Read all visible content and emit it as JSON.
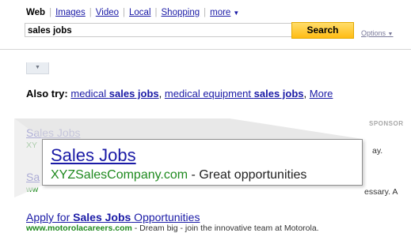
{
  "nav": {
    "web": "Web",
    "images": "Images",
    "video": "Video",
    "local": "Local",
    "shopping": "Shopping",
    "more": "more",
    "separator": "|"
  },
  "search": {
    "query": "sales jobs",
    "button_label": "Search",
    "options_label": "Options"
  },
  "icons": {
    "caret_down": "▼",
    "collapse": "▼"
  },
  "also_try": {
    "label": "Also try:",
    "items": [
      {
        "pre": "medical ",
        "bold": "sales jobs"
      },
      {
        "pre": "medical equipment ",
        "bold": "sales jobs"
      },
      {
        "pre": "More",
        "bold": ""
      }
    ],
    "comma": ","
  },
  "sponsor_label": "SPONSOR",
  "background_results": [
    {
      "title_fragment": "Sales Jobs",
      "url_fragment": "XY",
      "snippet_tail": "ay."
    },
    {
      "title_fragment": "Sa",
      "url_fragment": "ww",
      "snippet_tail": "essary. A"
    }
  ],
  "zoom_callout": {
    "title": "Sales Jobs",
    "url": "XYZSalesCompany.com",
    "dash": " - ",
    "description": "Great opportunities"
  },
  "apply_result": {
    "title_pre": "Apply for ",
    "title_bold": "Sales Jobs",
    "title_post": " Opportunities",
    "url": "www.motorolacareers.com",
    "snippet": " - Dream big - join the innovative team at Motorola."
  },
  "colors": {
    "link": "#1a1aa6",
    "url_green": "#1f8a1f",
    "search_button": "#ffc31f"
  }
}
